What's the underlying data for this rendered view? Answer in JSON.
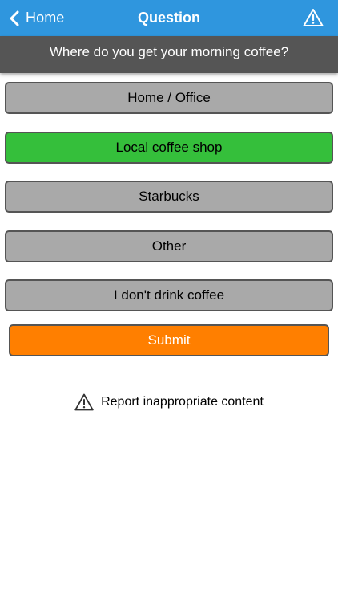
{
  "navbar": {
    "back_label": "Home",
    "title": "Question",
    "back_icon": "chevron-left-icon",
    "alert_icon": "warning-triangle-icon",
    "color": "#2f96de"
  },
  "question": {
    "text": "Where do you get your morning coffee?",
    "background": "#555555"
  },
  "options": [
    {
      "label": "Home / Office",
      "selected": false
    },
    {
      "label": "Local coffee shop",
      "selected": true
    },
    {
      "label": "Starbucks",
      "selected": false
    },
    {
      "label": "Other",
      "selected": false
    },
    {
      "label": "I don't drink coffee",
      "selected": false
    }
  ],
  "colors": {
    "option_default": "#a9a9a9",
    "option_selected": "#35bf3b",
    "submit": "#ff7f00"
  },
  "submit": {
    "label": "Submit"
  },
  "report": {
    "label": "Report inappropriate content",
    "icon": "warning-triangle-icon"
  }
}
